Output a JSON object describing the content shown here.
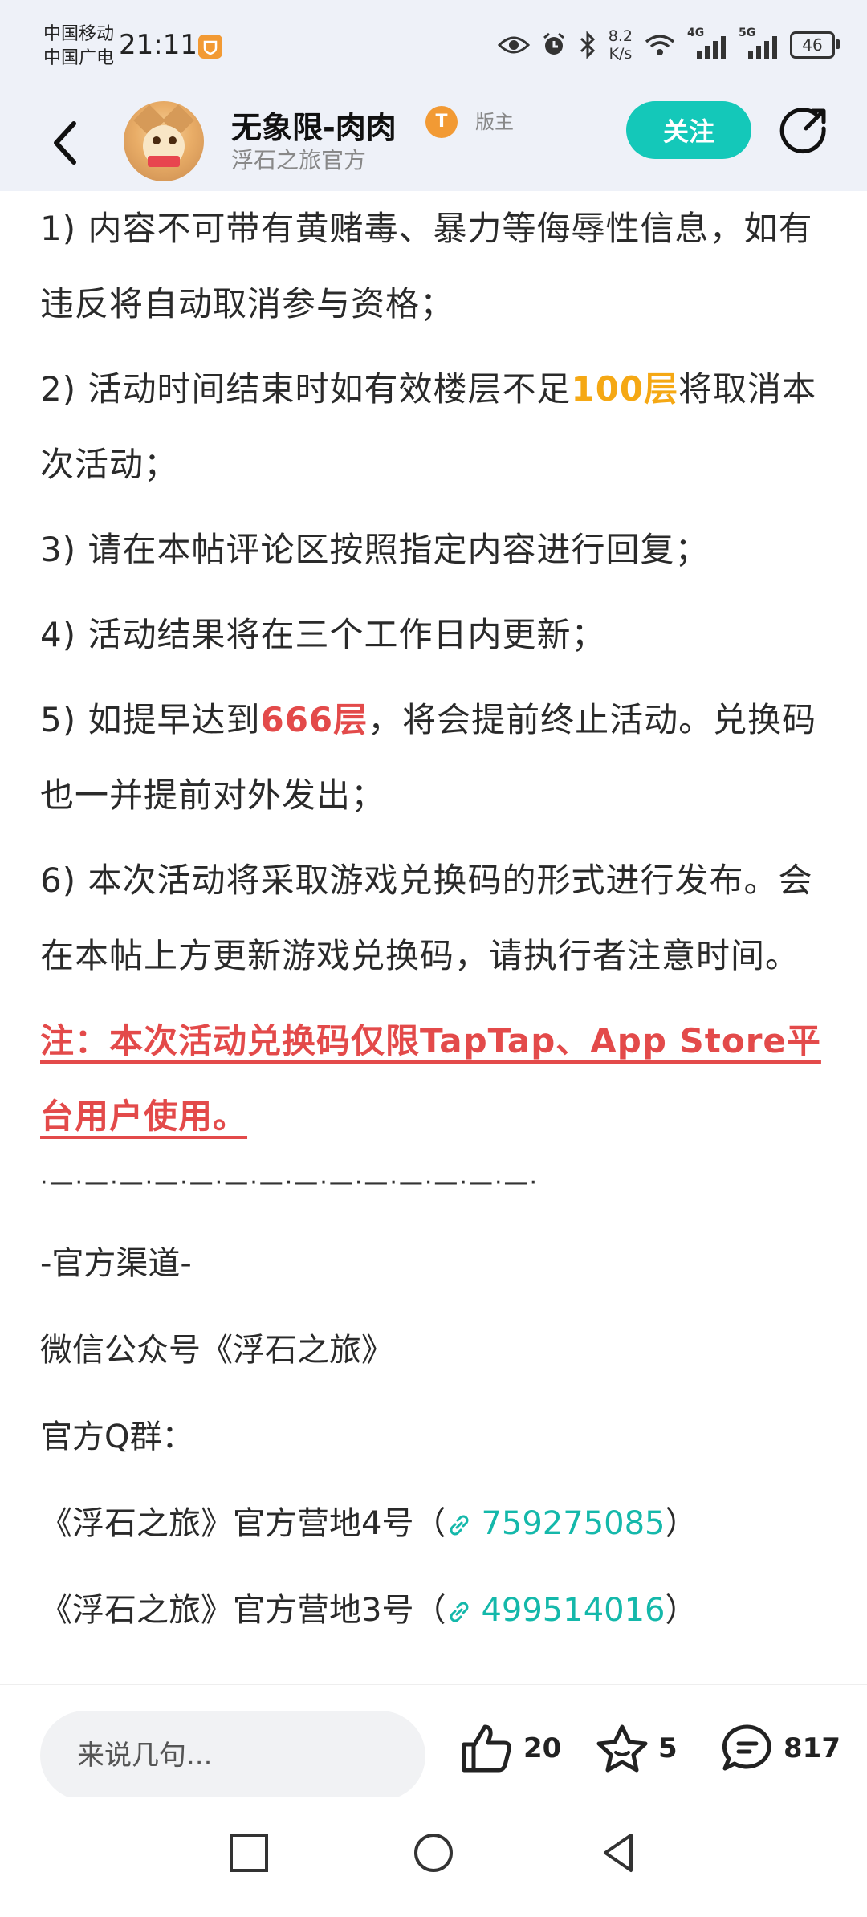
{
  "status_bar": {
    "carrier1": "中国移动",
    "carrier2": "中国广电",
    "time": "21:11",
    "net_speed_value": "8.2",
    "net_speed_unit": "K/s",
    "signal1_label": "4G",
    "signal2_label": "5G",
    "battery": "46"
  },
  "header": {
    "username": "无象限-肉肉",
    "badge": "T",
    "role": "版主",
    "subtitle": "浮石之旅官方",
    "follow_label": "关注"
  },
  "post": {
    "rules": [
      {
        "pre": "1) 内容不可带有黄赌毒、暴力等侮辱性信息，如有违反将自动取消参与资格；",
        "hl": "",
        "post": ""
      },
      {
        "pre": "2) 活动时间结束时如有效楼层不足",
        "hl": "100层",
        "post": "将取消本次活动；"
      },
      {
        "pre": "3) 请在本帖评论区按照指定内容进行回复；",
        "hl": "",
        "post": ""
      },
      {
        "pre": "4) 活动结果将在三个工作日内更新；",
        "hl": "",
        "post": ""
      },
      {
        "pre": "5) 如提早达到",
        "hl": "666层",
        "post": "，将会提前终止活动。兑换码也一并提前对外发出；"
      },
      {
        "pre": "6) 本次活动将采取游戏兑换码的形式进行发布。会在本帖上方更新游戏兑换码，请执行者注意时间。",
        "hl": "",
        "post": ""
      }
    ],
    "note": "注：本次活动兑换码仅限TapTap、App Store平台用户使用。",
    "divider": "·—·—·—·—·—·—·—·—·—·—·—·—·—·—·",
    "channel_title": "-官方渠道-",
    "wechat": "微信公众号《浮石之旅》",
    "qq_label": "官方Q群：",
    "groups": [
      {
        "name": "《浮石之旅》官方营地4号（",
        "number": "759275085",
        "close": "）"
      },
      {
        "name": "《浮石之旅》官方营地3号（",
        "number": "499514016",
        "close": "）"
      }
    ]
  },
  "bottom_bar": {
    "comment_placeholder": "来说几句...",
    "likes": "20",
    "favorites": "5",
    "comments": "817"
  },
  "icons": {
    "back": "chevron-left-icon",
    "share": "share-icon",
    "like": "thumb-up-icon",
    "favorite": "star-icon",
    "comment": "comment-icon",
    "link": "link-icon"
  },
  "colors": {
    "accent": "#14c8b9",
    "highlight_yellow": "#f5a814",
    "highlight_red": "#e34a4a",
    "link": "#14b8aa"
  }
}
